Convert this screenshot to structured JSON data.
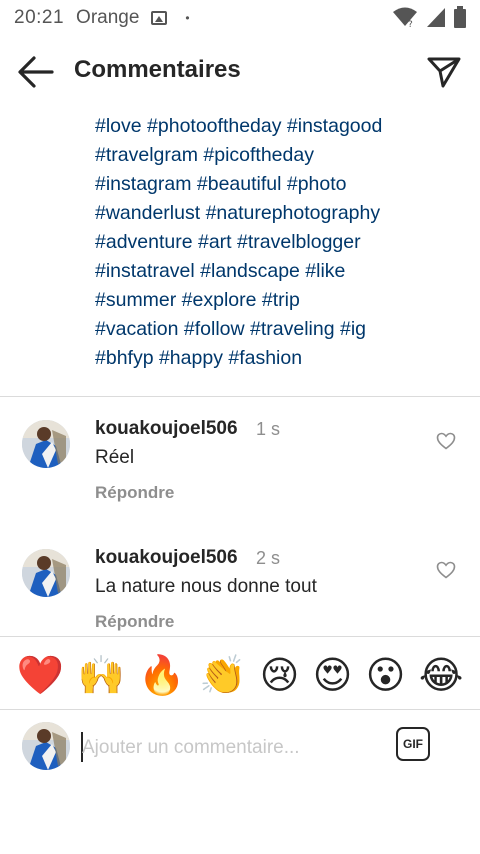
{
  "status_bar": {
    "time": "20:21",
    "carrier": "Orange",
    "dot": "•"
  },
  "header": {
    "title": "Commentaires"
  },
  "caption": {
    "lines": [
      "#love #photooftheday #instagood",
      "#travelgram #picoftheday",
      "#instagram #beautiful #photo",
      "#wanderlust #naturephotography",
      "#adventure #art #travelblogger",
      "#instatravel #landscape #like",
      "#summer #explore #trip",
      "#vacation #follow #traveling #ig",
      "#bhfyp #happy #fashion"
    ]
  },
  "comments": [
    {
      "username": "kouakoujoel506",
      "time": "1 s",
      "text": "Réel",
      "reply_label": "Répondre"
    },
    {
      "username": "kouakoujoel506",
      "time": "2 s",
      "text": "La nature nous donne tout",
      "reply_label": "Répondre"
    }
  ],
  "emojis": [
    "❤️",
    "🙌",
    "🔥",
    "👏",
    "😢",
    "😍",
    "😮",
    "😂"
  ],
  "composer": {
    "placeholder": "Ajouter un commentaire...",
    "gif_label": "GIF"
  },
  "colors": {
    "hashtag": "#00376b",
    "muted": "#8e8e8e",
    "divider": "#dbdbdb"
  }
}
